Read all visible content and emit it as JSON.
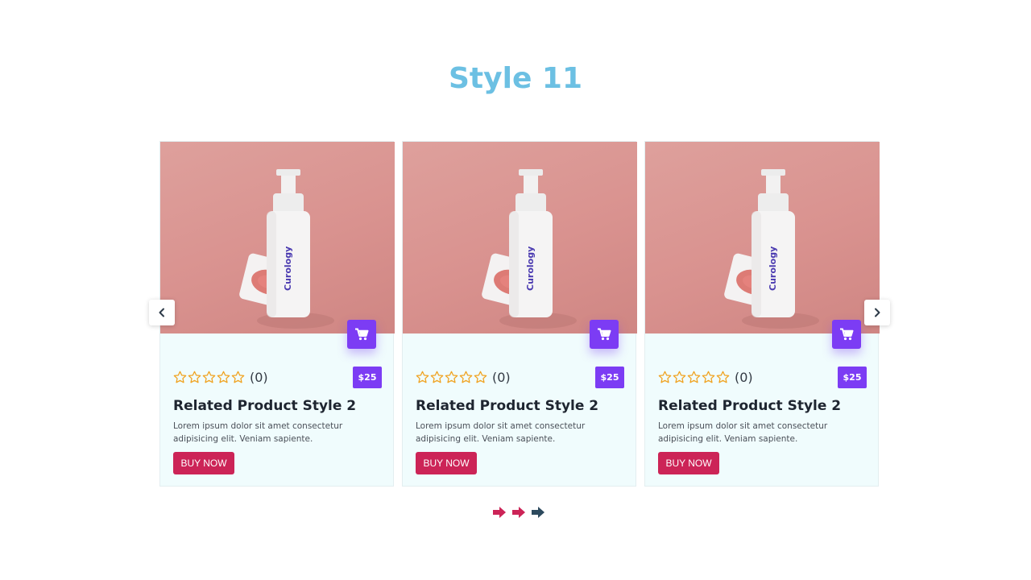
{
  "section": {
    "title": "Style 11"
  },
  "products": [
    {
      "image_label": "Curology",
      "rating_count": "(0)",
      "price": "$25",
      "name": "Related Product Style 2",
      "description": "Lorem ipsum dolor sit amet consectetur adipisicing elit. Veniam sapiente.",
      "buy_label": "BUY NOW",
      "stars": 0,
      "max_stars": 5
    },
    {
      "image_label": "Curology",
      "rating_count": "(0)",
      "price": "$25",
      "name": "Related Product Style 2",
      "description": "Lorem ipsum dolor sit amet consectetur adipisicing elit. Veniam sapiente.",
      "buy_label": "BUY NOW",
      "stars": 0,
      "max_stars": 5
    },
    {
      "image_label": "Curology",
      "rating_count": "(0)",
      "price": "$25",
      "name": "Related Product Style 2",
      "description": "Lorem ipsum dolor sit amet consectetur adipisicing elit. Veniam sapiente.",
      "buy_label": "BUY NOW",
      "stars": 0,
      "max_stars": 5
    }
  ],
  "icons": {
    "cart": "cart-icon",
    "star": "star-outline-icon",
    "prev": "chevron-left-icon",
    "next": "chevron-right-icon",
    "dot": "arrow-right-icon"
  },
  "pagination": {
    "pages": 3,
    "active_page": 3
  },
  "colors": {
    "title": "#6cc0e3",
    "accent_purple": "#7c3cf4",
    "buy_button": "#cc2457",
    "card_background": "#f0fcfd",
    "star": "#f0a21f",
    "dot_inactive": "#cc2457",
    "dot_active": "#2d4a5e"
  }
}
